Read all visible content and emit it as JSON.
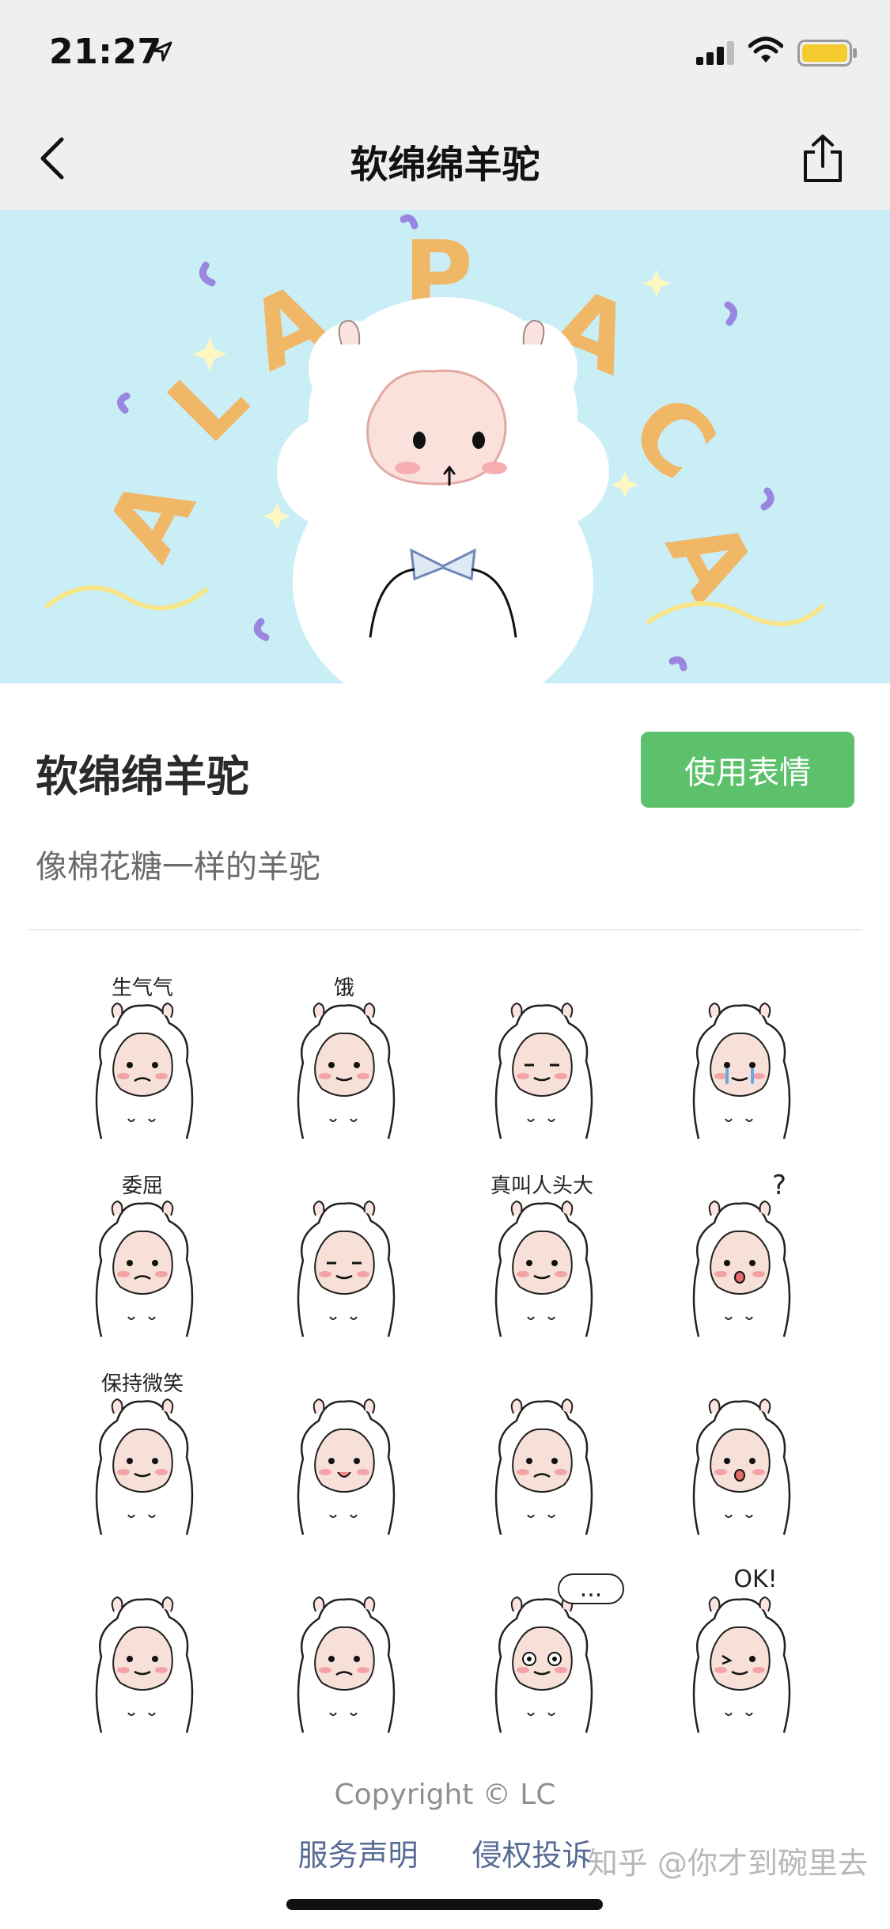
{
  "status_bar": {
    "time": "21:27"
  },
  "nav": {
    "title": "软绵绵羊驼"
  },
  "banner": {
    "lettering": "ALAPACA"
  },
  "pack": {
    "name": "软绵绵羊驼",
    "use_button": "使用表情",
    "description": "像棉花糖一样的羊驼"
  },
  "stickers": [
    {
      "caption": "生气气"
    },
    {
      "caption": "饿"
    },
    {
      "caption": ""
    },
    {
      "caption": ""
    },
    {
      "caption": "委屈"
    },
    {
      "caption": ""
    },
    {
      "caption": "真叫人头大"
    },
    {
      "caption": "?"
    },
    {
      "caption": "保持微笑"
    },
    {
      "caption": ""
    },
    {
      "caption": ""
    },
    {
      "caption": ""
    },
    {
      "caption": ""
    },
    {
      "caption": ""
    },
    {
      "caption": "..."
    },
    {
      "caption": "OK!"
    }
  ],
  "footer": {
    "copyright": "Copyright © LC",
    "links": [
      "服务声明",
      "侵权投诉"
    ]
  },
  "watermark": "知乎 @你才到碗里去",
  "colors": {
    "accent_green": "#5cc16a",
    "link_blue": "#576b95",
    "banner_bg": "#c9eef6"
  }
}
